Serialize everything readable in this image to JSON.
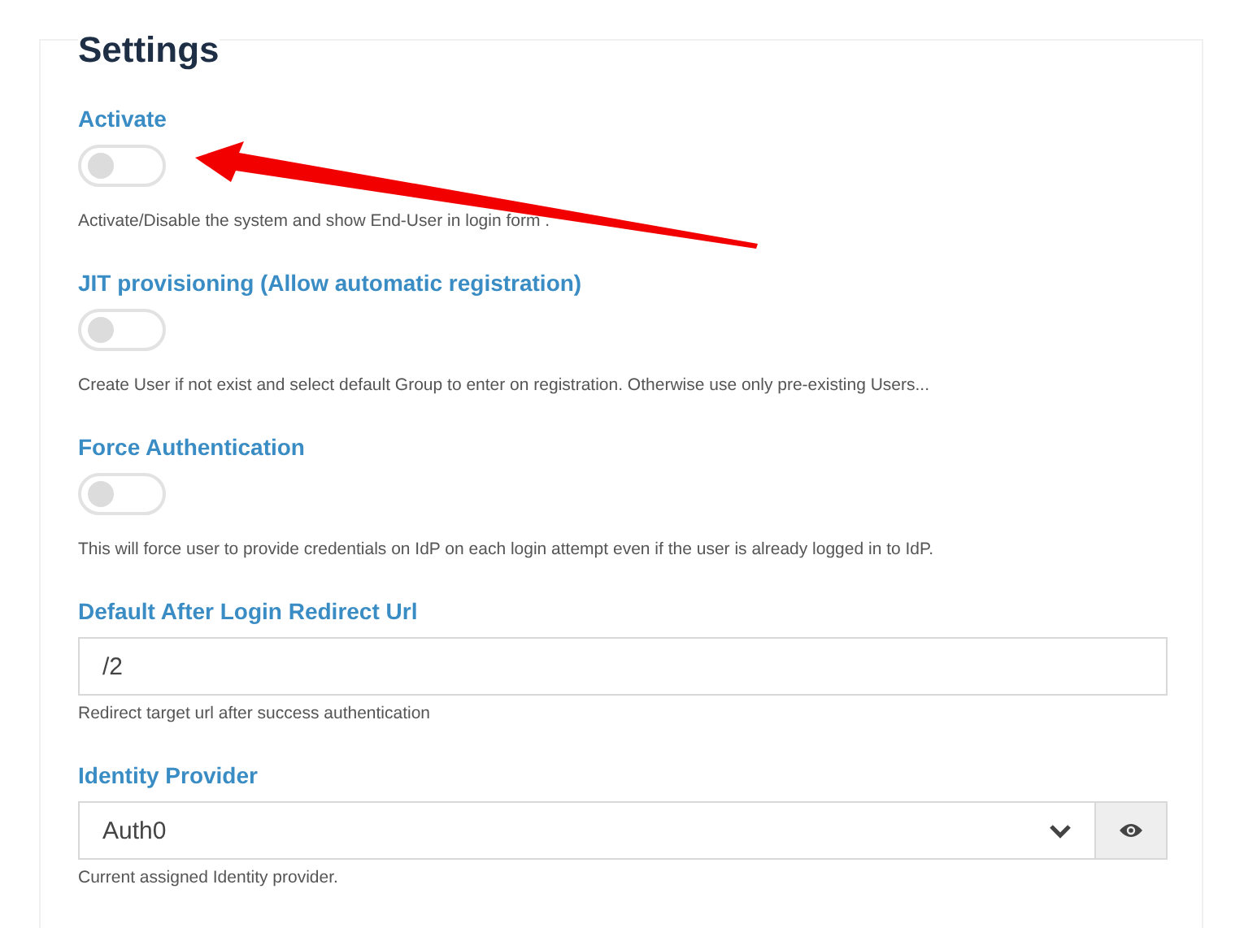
{
  "title": "Settings",
  "settings": [
    {
      "kind": "toggle",
      "label": "Activate",
      "on": false,
      "help": "Activate/Disable the system and show End-User in login form ."
    },
    {
      "kind": "toggle",
      "label": "JIT provisioning (Allow automatic registration)",
      "on": false,
      "help": "Create User if not exist and select default Group to enter on registration. Otherwise use only pre-existing Users..."
    },
    {
      "kind": "toggle",
      "label": "Force Authentication",
      "on": false,
      "help": "This will force user to provide credentials on IdP on each login attempt even if the user is already logged in to IdP."
    },
    {
      "kind": "text",
      "label": "Default After Login Redirect Url",
      "value": "/2",
      "help": "Redirect target url after success authentication"
    },
    {
      "kind": "select",
      "label": "Identity Provider",
      "value": "Auth0",
      "help": "Current assigned Identity provider."
    }
  ]
}
